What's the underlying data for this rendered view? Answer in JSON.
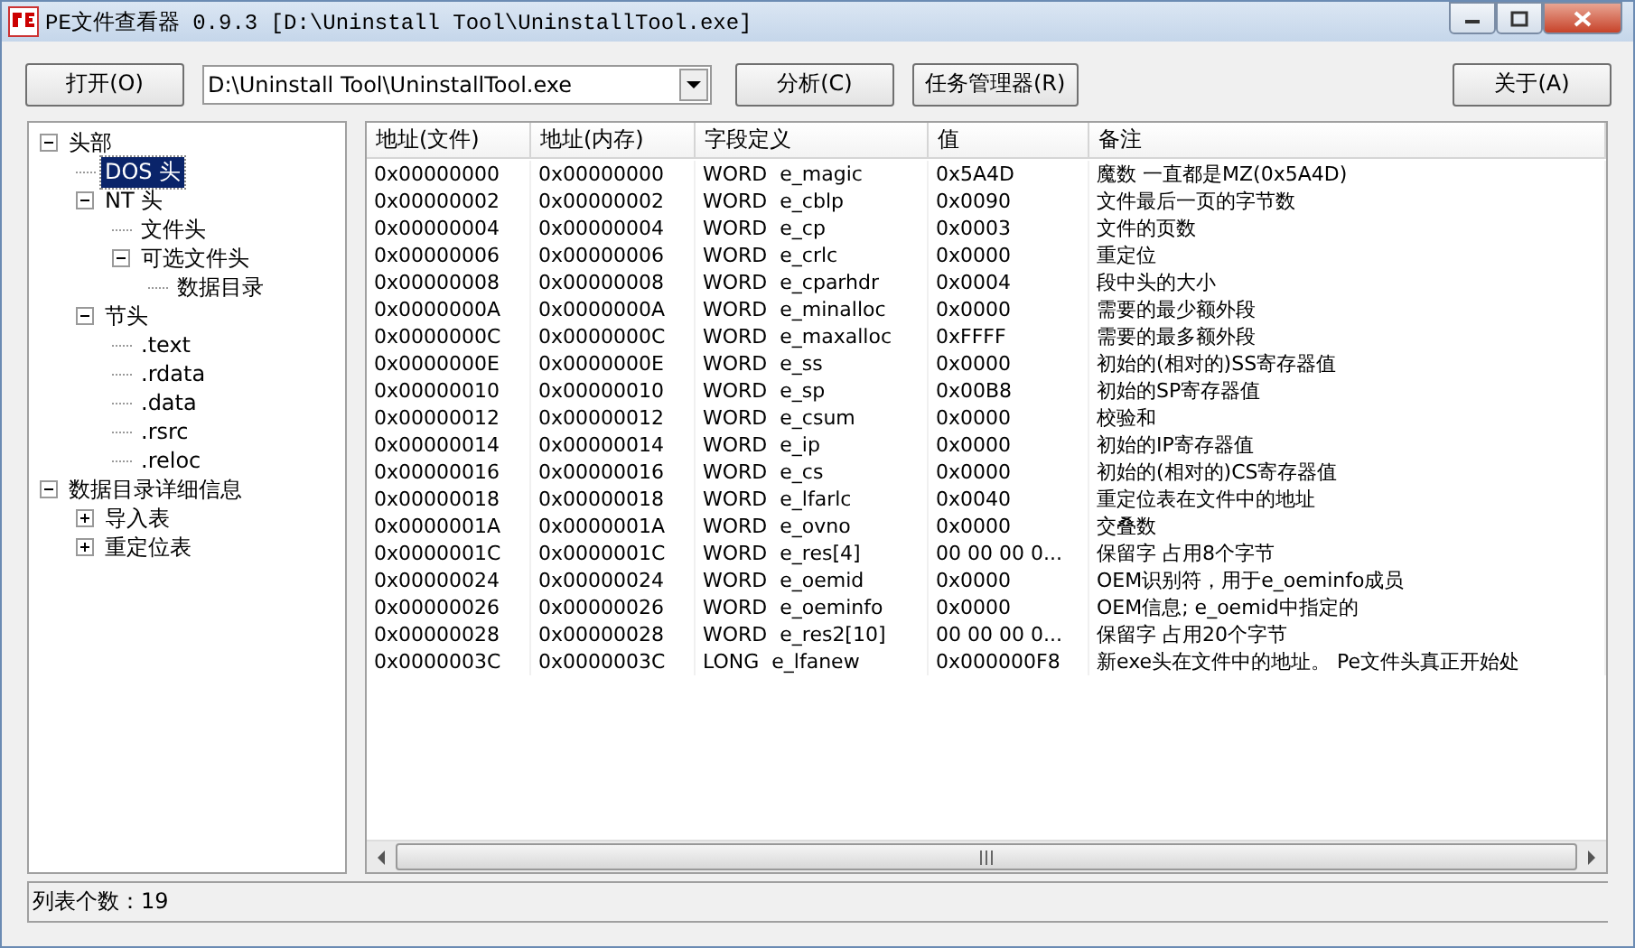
{
  "window": {
    "title": "PE文件查看器 0.9.3 [D:\\Uninstall Tool\\UninstallTool.exe]"
  },
  "toolbar": {
    "open_button": "打开(O)",
    "file_path": "D:\\Uninstall Tool\\UninstallTool.exe",
    "analyze_button": "分析(C)",
    "task_manager_button": "任务管理器(R)",
    "about_button": "关于(A)"
  },
  "tree": [
    {
      "label": "头部",
      "expanded": true,
      "selected": false,
      "children": [
        {
          "label": "DOS 头",
          "selected": true
        },
        {
          "label": "NT 头",
          "expanded": true,
          "selected": false,
          "children": [
            {
              "label": "文件头",
              "selected": false
            },
            {
              "label": "可选文件头",
              "expanded": true,
              "selected": false,
              "children": [
                {
                  "label": "数据目录",
                  "selected": false
                }
              ]
            }
          ]
        },
        {
          "label": "节头",
          "expanded": true,
          "selected": false,
          "children": [
            {
              "label": ".text",
              "selected": false
            },
            {
              "label": ".rdata",
              "selected": false
            },
            {
              "label": ".data",
              "selected": false
            },
            {
              "label": ".rsrc",
              "selected": false
            },
            {
              "label": ".reloc",
              "selected": false
            }
          ]
        }
      ]
    },
    {
      "label": "数据目录详细信息",
      "expanded": true,
      "selected": false,
      "children": [
        {
          "label": "导入表",
          "expanded": false,
          "selected": false
        },
        {
          "label": "重定位表",
          "expanded": false,
          "selected": false
        }
      ]
    }
  ],
  "table": {
    "columns": [
      "地址(文件)",
      "地址(内存)",
      "字段定义",
      "值",
      "备注"
    ],
    "rows": [
      [
        "0x00000000",
        "0x00000000",
        "WORD  e_magic",
        "0x5A4D",
        "魔数 一直都是MZ(0x5A4D)"
      ],
      [
        "0x00000002",
        "0x00000002",
        "WORD  e_cblp",
        "0x0090",
        "文件最后一页的字节数"
      ],
      [
        "0x00000004",
        "0x00000004",
        "WORD  e_cp",
        "0x0003",
        "文件的页数"
      ],
      [
        "0x00000006",
        "0x00000006",
        "WORD  e_crlc",
        "0x0000",
        "重定位"
      ],
      [
        "0x00000008",
        "0x00000008",
        "WORD  e_cparhdr",
        "0x0004",
        "段中头的大小"
      ],
      [
        "0x0000000A",
        "0x0000000A",
        "WORD  e_minalloc",
        "0x0000",
        "需要的最少额外段"
      ],
      [
        "0x0000000C",
        "0x0000000C",
        "WORD  e_maxalloc",
        "0xFFFF",
        "需要的最多额外段"
      ],
      [
        "0x0000000E",
        "0x0000000E",
        "WORD  e_ss",
        "0x0000",
        "初始的(相对的)SS寄存器值"
      ],
      [
        "0x00000010",
        "0x00000010",
        "WORD  e_sp",
        "0x00B8",
        "初始的SP寄存器值"
      ],
      [
        "0x00000012",
        "0x00000012",
        "WORD  e_csum",
        "0x0000",
        "校验和"
      ],
      [
        "0x00000014",
        "0x00000014",
        "WORD  e_ip",
        "0x0000",
        "初始的IP寄存器值"
      ],
      [
        "0x00000016",
        "0x00000016",
        "WORD  e_cs",
        "0x0000",
        "初始的(相对的)CS寄存器值"
      ],
      [
        "0x00000018",
        "0x00000018",
        "WORD  e_lfarlc",
        "0x0040",
        "重定位表在文件中的地址"
      ],
      [
        "0x0000001A",
        "0x0000001A",
        "WORD  e_ovno",
        "0x0000",
        "交叠数"
      ],
      [
        "0x0000001C",
        "0x0000001C",
        "WORD  e_res[4]",
        "00 00 00 0...",
        "保留字 占用8个字节"
      ],
      [
        "0x00000024",
        "0x00000024",
        "WORD  e_oemid",
        "0x0000",
        "OEM识别符，用于e_oeminfo成员"
      ],
      [
        "0x00000026",
        "0x00000026",
        "WORD  e_oeminfo",
        "0x0000",
        "OEM信息; e_oemid中指定的"
      ],
      [
        "0x00000028",
        "0x00000028",
        "WORD  e_res2[10]",
        "00 00 00 0...",
        "保留字 占用20个字节"
      ],
      [
        "0x0000003C",
        "0x0000003C",
        "LONG  e_lfanew",
        "0x000000F8",
        "新exe头在文件中的地址。 Pe文件头真正开始处"
      ]
    ]
  },
  "status_bar": "列表个数：19"
}
